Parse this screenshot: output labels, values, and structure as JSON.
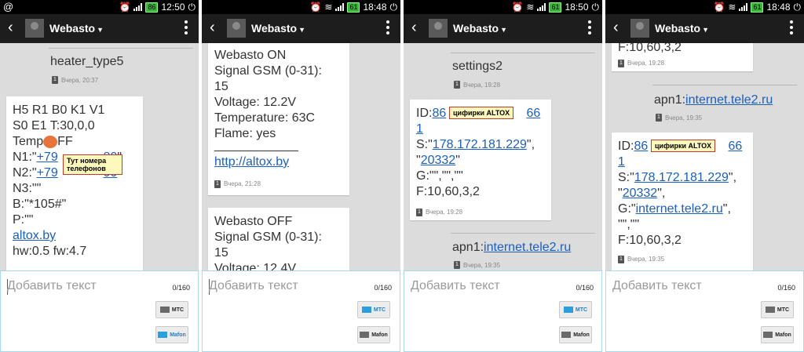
{
  "colors": {
    "link": "#1c5fbd",
    "note_border": "#c0392b",
    "accent": "#2a9fe0"
  },
  "panels": [
    {
      "status": {
        "left": "@",
        "batt": "86",
        "time": "12:50"
      },
      "title": "Webasto",
      "sent": {
        "text": "heater_type5",
        "time": "Вчера, 20:37"
      },
      "bubble": {
        "line1": "H5 R1 B0 K1 V1",
        "line2": "S0 E1 T:30,0,0",
        "line3": "Temp",
        "line3b": "FF",
        "n1a": "N1:\"",
        "n1b": "+79",
        "n1c": "80",
        "n1d": "\"",
        "n2a": "N2:\"",
        "n2b": "+79",
        "n2c": "00",
        "n2d": "\"",
        "n3": "N3:\"\"",
        "b": "B:\"*105#\"",
        "p": "P:\"\"",
        "link": "altox.by",
        "hw": "hw:0.5 fw:4.7"
      },
      "note": "Тут номера\nтелефонов",
      "compose": {
        "placeholder": "Добавить текст",
        "count": "0/160",
        "btn1": "МТС",
        "btn2": "Mafon"
      }
    },
    {
      "status": {
        "batt": "61",
        "time": "18:48"
      },
      "title": "Webasto",
      "bubble1": {
        "text": "Webasto ON\nSignal GSM (0-31):\n15\nVoltage: 12.2V\nTemperature: 63C\nFlame: yes\n",
        "sep": "____________",
        "link": "http://altox.by",
        "time": "Вчера, 21:28"
      },
      "bubble2": {
        "text": "Webasto OFF\nSignal GSM (0-31):\n15\nVoltage: 12.4V"
      },
      "compose": {
        "placeholder": "Добавить текст",
        "count": "0/160",
        "btn1": "МТС",
        "btn2": "Mafon"
      }
    },
    {
      "status": {
        "batt": "61",
        "time": "18:50"
      },
      "title": "Webasto",
      "sent1": {
        "text": "settings2",
        "time": "Вчера, 19:28"
      },
      "bubble": {
        "id_a": "ID:",
        "id_b": "86",
        "id_c": "66",
        "one": "1",
        "s_a": "S:\"",
        "s_link": "178.172.181.229",
        "s_b": "\",",
        "port_a": "\"",
        "port_link": "20332",
        "port_b": "\"",
        "g": "G:\"\",\"\",\"\"",
        "f": "F:10,60,3,2",
        "time": "Вчера, 19:28"
      },
      "note": "цифирки ALTOX",
      "sent2": {
        "prefix": "apn1:",
        "link": "internet.tele2.ru",
        "time": "Вчера, 19:35"
      },
      "compose": {
        "placeholder": "Добавить текст",
        "count": "0/160",
        "btn1": "МТС",
        "btn2": "Mafon"
      }
    },
    {
      "status": {
        "batt": "61",
        "time": "18:48"
      },
      "title": "Webasto",
      "top": {
        "text": "F:10,60,3,2",
        "time": "Вчера, 19:28"
      },
      "sent": {
        "prefix": "apn1:",
        "link": "internet.tele2.ru",
        "time": "Вчера, 19:35"
      },
      "bubble": {
        "id_a": "ID:",
        "id_b": "86",
        "id_c": "66",
        "one": "1",
        "s_a": "S:\"",
        "s_link": "178.172.181.229",
        "s_b": "\",",
        "port_a": "\"",
        "port_link": "20332",
        "port_b": "\",",
        "g_a": "G:\"",
        "g_link": "internet.tele2.ru",
        "g_b": "\",",
        "g2": "\"\",\"\"",
        "f": "F:10,60,3,2",
        "time": "Вчера, 19:35"
      },
      "note": "цифирки ALTOX",
      "compose": {
        "placeholder": "Добавить текст",
        "count": "0/160",
        "btn1": "МТС",
        "btn2": "Mafon"
      }
    }
  ]
}
